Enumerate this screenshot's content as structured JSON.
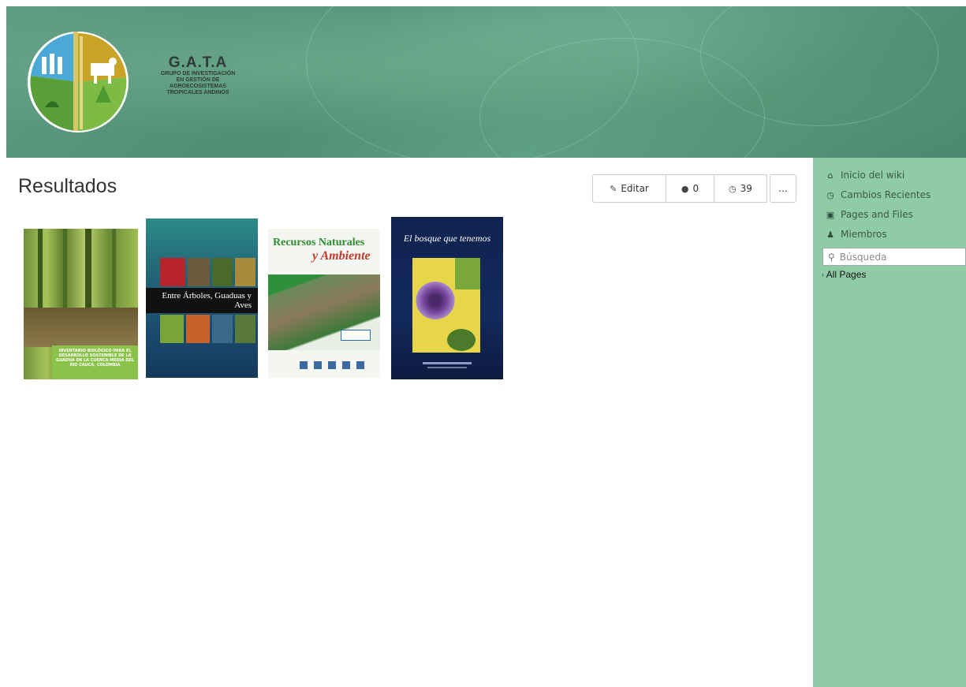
{
  "header": {
    "logo_title": "G.A.T.A",
    "logo_subtitle_lines": [
      "GRUPO DE INVESTIGACIÓN",
      "EN GESTIÓN DE",
      "AGROECOSISTEMAS",
      "TROPICALES ANDINOS"
    ]
  },
  "page": {
    "title": "Resultados"
  },
  "toolbar": {
    "edit_label": "Editar",
    "comments_count": "0",
    "history_count": "39",
    "more_label": "..."
  },
  "covers": [
    {
      "title": "",
      "band_text": "INVENTARIO BIOLÓGICO PARA EL DESARROLLO SOSTENIBLE DE LA GUADUA EN LA CUENCA MEDIA DEL RÍO CAUCA, COLOMBIA"
    },
    {
      "title": "Entre Árboles, Guaduas y Aves"
    },
    {
      "title_line1": "Recursos Naturales",
      "title_line2": "y Ambiente"
    },
    {
      "title": "El bosque que tenemos"
    }
  ],
  "sidebar": {
    "items": [
      {
        "label": "Inicio del wiki",
        "icon": "home-icon"
      },
      {
        "label": "Cambios Recientes",
        "icon": "clock-icon"
      },
      {
        "label": "Pages and Files",
        "icon": "file-icon"
      },
      {
        "label": "Miembros",
        "icon": "user-icon"
      }
    ],
    "search_placeholder": "Búsqueda",
    "all_pages_label": "All Pages"
  },
  "colors": {
    "sidebar_bg": "#8fcca5",
    "banner_base": "#5e9c83"
  }
}
